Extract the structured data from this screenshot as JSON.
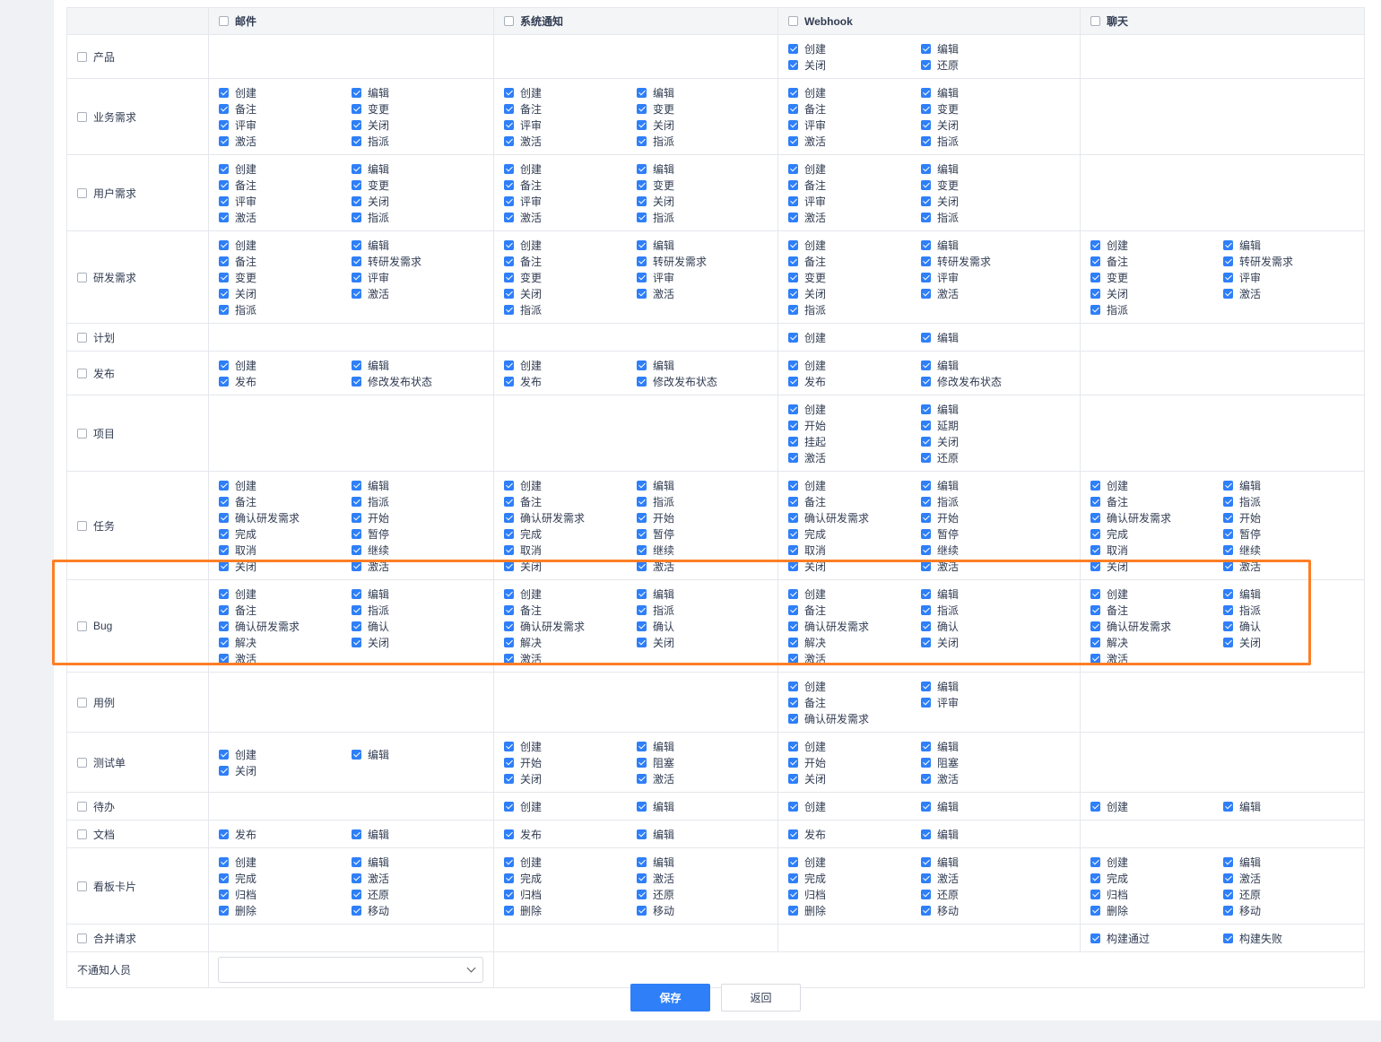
{
  "columns": [
    "邮件",
    "系统通知",
    "Webhook",
    "聊天"
  ],
  "rows": [
    {
      "name": "产品",
      "h": 47,
      "cells": [
        [],
        [],
        [
          "创建",
          "编辑",
          "关闭",
          "还原"
        ],
        []
      ]
    },
    {
      "name": "业务需求",
      "h": 84,
      "cells": [
        [
          "创建",
          "编辑",
          "备注",
          "变更",
          "评审",
          "关闭",
          "激活",
          "指派"
        ],
        [
          "创建",
          "编辑",
          "备注",
          "变更",
          "评审",
          "关闭",
          "激活",
          "指派"
        ],
        [
          "创建",
          "编辑",
          "备注",
          "变更",
          "评审",
          "关闭",
          "激活",
          "指派"
        ],
        []
      ]
    },
    {
      "name": "用户需求",
      "h": 84,
      "cells": [
        [
          "创建",
          "编辑",
          "备注",
          "变更",
          "评审",
          "关闭",
          "激活",
          "指派"
        ],
        [
          "创建",
          "编辑",
          "备注",
          "变更",
          "评审",
          "关闭",
          "激活",
          "指派"
        ],
        [
          "创建",
          "编辑",
          "备注",
          "变更",
          "评审",
          "关闭",
          "激活",
          "指派"
        ],
        []
      ]
    },
    {
      "name": "研发需求",
      "h": 101,
      "cells": [
        [
          "创建",
          "编辑",
          "备注",
          "转研发需求",
          "变更",
          "评审",
          "关闭",
          "激活",
          "指派"
        ],
        [
          "创建",
          "编辑",
          "备注",
          "转研发需求",
          "变更",
          "评审",
          "关闭",
          "激活",
          "指派"
        ],
        [
          "创建",
          "编辑",
          "备注",
          "转研发需求",
          "变更",
          "评审",
          "关闭",
          "激活",
          "指派"
        ],
        [
          "创建",
          "编辑",
          "备注",
          "转研发需求",
          "变更",
          "评审",
          "关闭",
          "激活",
          "指派"
        ]
      ]
    },
    {
      "name": "计划",
      "h": 29,
      "cells": [
        [],
        [],
        [
          "创建",
          "编辑"
        ],
        []
      ]
    },
    {
      "name": "发布",
      "h": 48,
      "cells": [
        [
          "创建",
          "编辑",
          "发布",
          "修改发布状态"
        ],
        [
          "创建",
          "编辑",
          "发布",
          "修改发布状态"
        ],
        [
          "创建",
          "编辑",
          "发布",
          "修改发布状态"
        ],
        []
      ]
    },
    {
      "name": "项目",
      "h": 84,
      "cells": [
        [],
        [],
        [
          "创建",
          "编辑",
          "开始",
          "延期",
          "挂起",
          "关闭",
          "激活",
          "还原"
        ],
        []
      ]
    },
    {
      "name": "任务",
      "h": 120,
      "cells": [
        [
          "创建",
          "编辑",
          "备注",
          "指派",
          "确认研发需求",
          "开始",
          "完成",
          "暂停",
          "取消",
          "继续",
          "关闭",
          "激活"
        ],
        [
          "创建",
          "编辑",
          "备注",
          "指派",
          "确认研发需求",
          "开始",
          "完成",
          "暂停",
          "取消",
          "继续",
          "关闭",
          "激活"
        ],
        [
          "创建",
          "编辑",
          "备注",
          "指派",
          "确认研发需求",
          "开始",
          "完成",
          "暂停",
          "取消",
          "继续",
          "关闭",
          "激活"
        ],
        [
          "创建",
          "编辑",
          "备注",
          "指派",
          "确认研发需求",
          "开始",
          "完成",
          "暂停",
          "取消",
          "继续",
          "关闭",
          "激活"
        ]
      ]
    },
    {
      "name": "Bug",
      "h": 102,
      "cells": [
        [
          "创建",
          "编辑",
          "备注",
          "指派",
          "确认研发需求",
          "确认",
          "解决",
          "关闭",
          "激活"
        ],
        [
          "创建",
          "编辑",
          "备注",
          "指派",
          "确认研发需求",
          "确认",
          "解决",
          "关闭",
          "激活"
        ],
        [
          "创建",
          "编辑",
          "备注",
          "指派",
          "确认研发需求",
          "确认",
          "解决",
          "关闭",
          "激活"
        ],
        [
          "创建",
          "编辑",
          "备注",
          "指派",
          "确认研发需求",
          "确认",
          "解决",
          "关闭",
          "激活"
        ]
      ]
    },
    {
      "name": "用例",
      "h": 65,
      "cells": [
        [],
        [],
        [
          "创建",
          "编辑",
          "备注",
          "评审",
          "确认研发需求"
        ],
        []
      ]
    },
    {
      "name": "测试单",
      "h": 66,
      "cells": [
        [
          "创建",
          "编辑",
          "关闭"
        ],
        [
          "创建",
          "编辑",
          "开始",
          "阻塞",
          "关闭",
          "激活"
        ],
        [
          "创建",
          "编辑",
          "开始",
          "阻塞",
          "关闭",
          "激活"
        ],
        []
      ]
    },
    {
      "name": "待办",
      "h": 29,
      "cells": [
        [],
        [
          "创建",
          "编辑"
        ],
        [
          "创建",
          "编辑"
        ],
        [
          "创建",
          "编辑"
        ]
      ]
    },
    {
      "name": "文档",
      "h": 30,
      "cells": [
        [
          "发布",
          "编辑"
        ],
        [
          "发布",
          "编辑"
        ],
        [
          "发布",
          "编辑"
        ],
        []
      ]
    },
    {
      "name": "看板卡片",
      "h": 84,
      "cells": [
        [
          "创建",
          "编辑",
          "完成",
          "激活",
          "归档",
          "还原",
          "删除",
          "移动"
        ],
        [
          "创建",
          "编辑",
          "完成",
          "激活",
          "归档",
          "还原",
          "删除",
          "移动"
        ],
        [
          "创建",
          "编辑",
          "完成",
          "激活",
          "归档",
          "还原",
          "删除",
          "移动"
        ],
        [
          "创建",
          "编辑",
          "完成",
          "激活",
          "归档",
          "还原",
          "删除",
          "移动"
        ]
      ]
    },
    {
      "name": "合并请求",
      "h": 29,
      "cells": [
        [],
        [],
        [],
        [
          "构建通过",
          "构建失败"
        ]
      ]
    }
  ],
  "exclude_label": "不通知人员",
  "exclude_value": "",
  "save_label": "保存",
  "back_label": "返回",
  "highlight_row": "Bug",
  "colors": {
    "accent": "#2e7ff8",
    "highlight": "#fd7e25"
  }
}
